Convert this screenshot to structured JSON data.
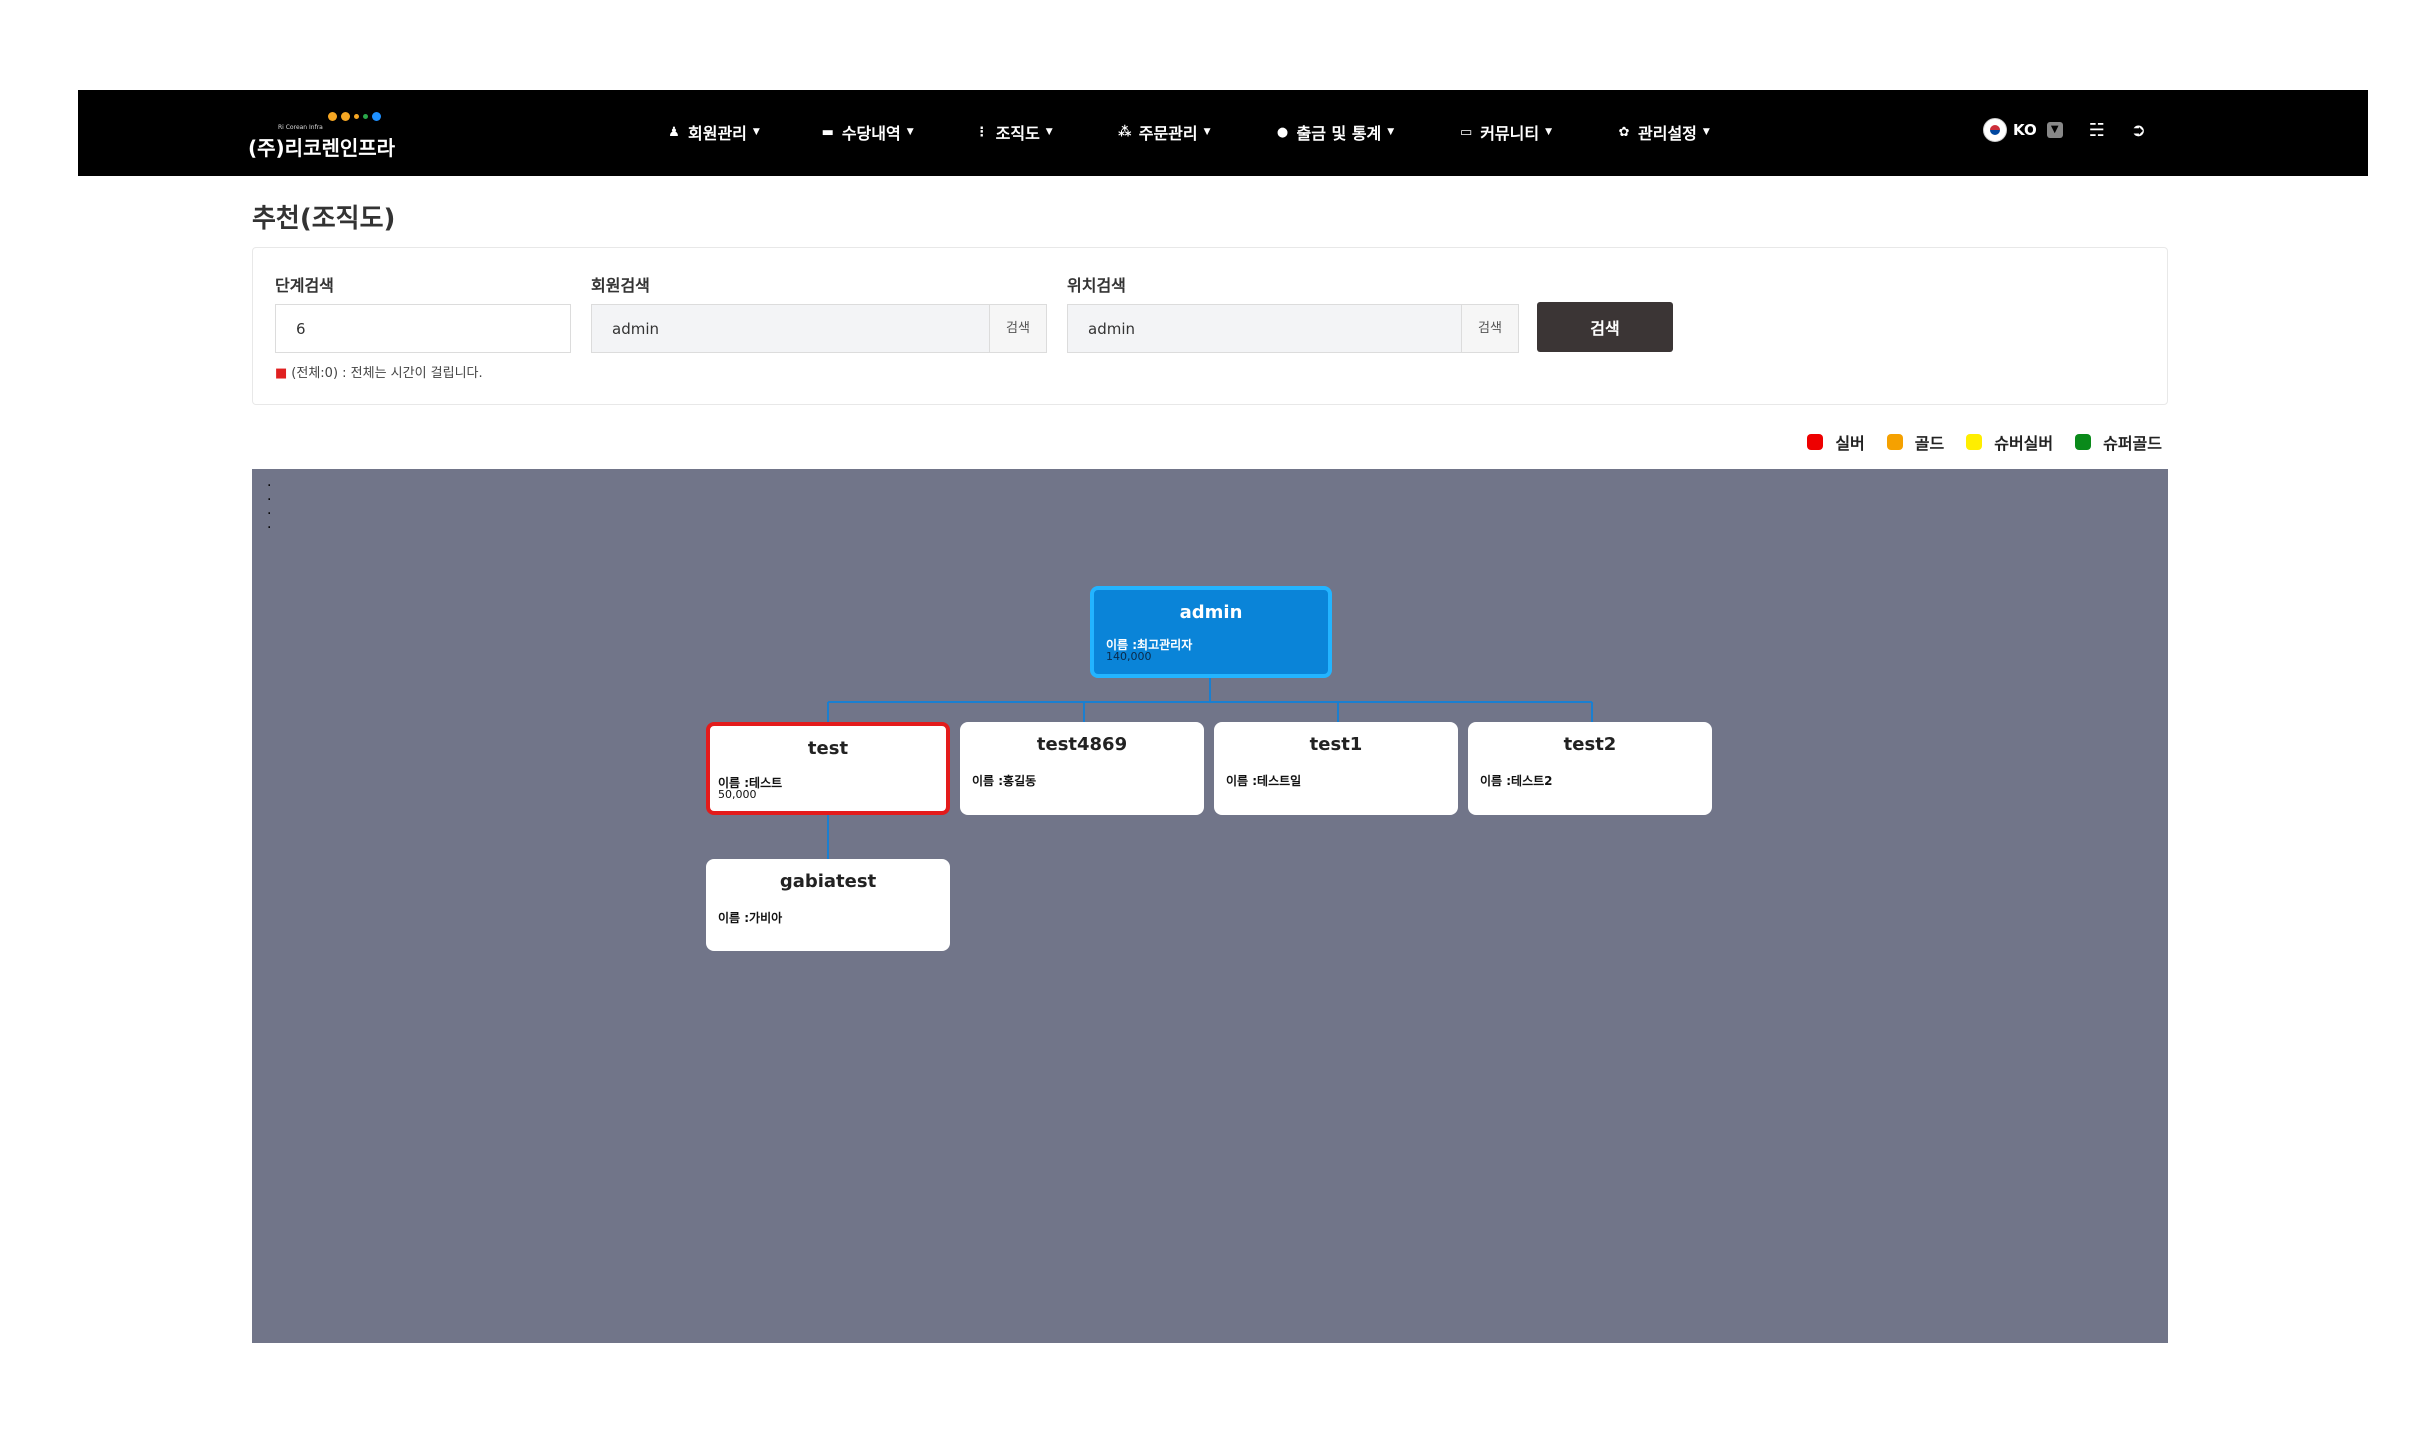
{
  "header": {
    "logo_small": "Ri Corean Infra",
    "logo_main": "(주)리코렌인프라",
    "logo_dot_colors": [
      "#f5a623",
      "#f5a623",
      "#f5a623",
      "#2aa84a",
      "#1e90ff"
    ],
    "nav": [
      {
        "label": "회원관리",
        "icon": "user-icon",
        "glyph": "👤"
      },
      {
        "label": "수당내역",
        "icon": "card-icon",
        "glyph": "▬"
      },
      {
        "label": "조직도",
        "icon": "org-chart-icon",
        "glyph": "⋮"
      },
      {
        "label": "주문관리",
        "icon": "cubes-icon",
        "glyph": "⁂"
      },
      {
        "label": "출금 및 통계",
        "icon": "coin-icon",
        "glyph": "●"
      },
      {
        "label": "커뮤니티",
        "icon": "monitor-icon",
        "glyph": "▭"
      },
      {
        "label": "관리설정",
        "icon": "gear-icon",
        "glyph": "✿"
      }
    ],
    "lang": "KO"
  },
  "page": {
    "title": "추천(조직도)"
  },
  "search": {
    "level_label": "단계검색",
    "level_value": "6",
    "member_label": "회원검색",
    "member_value": "admin",
    "member_btn": "검색",
    "position_label": "위치검색",
    "position_value": "admin",
    "position_btn": "검색",
    "submit": "검색",
    "note": "(전체:0) : 전체는 시간이 걸립니다."
  },
  "legend": [
    {
      "label": "실버",
      "color": "#ee0000"
    },
    {
      "label": "골드",
      "color": "#f5a100"
    },
    {
      "label": "슈버실버",
      "color": "#ffee00"
    },
    {
      "label": "슈퍼골드",
      "color": "#0a8a1a"
    }
  ],
  "tree": {
    "root": {
      "id": "admin",
      "name": "이름 :최고관리자",
      "points": "140,000"
    },
    "children": [
      {
        "id": "test",
        "name": "이름 :테스트",
        "points": "50,000",
        "highlight": "red"
      },
      {
        "id": "test4869",
        "name": "이름 :홍길동",
        "points": ""
      },
      {
        "id": "test1",
        "name": "이름 :테스트일",
        "points": ""
      },
      {
        "id": "test2",
        "name": "이름 :테스트2",
        "points": ""
      }
    ],
    "grandchildren": [
      {
        "id": "gabiatest",
        "name": "이름 :가비아",
        "points": ""
      }
    ]
  }
}
